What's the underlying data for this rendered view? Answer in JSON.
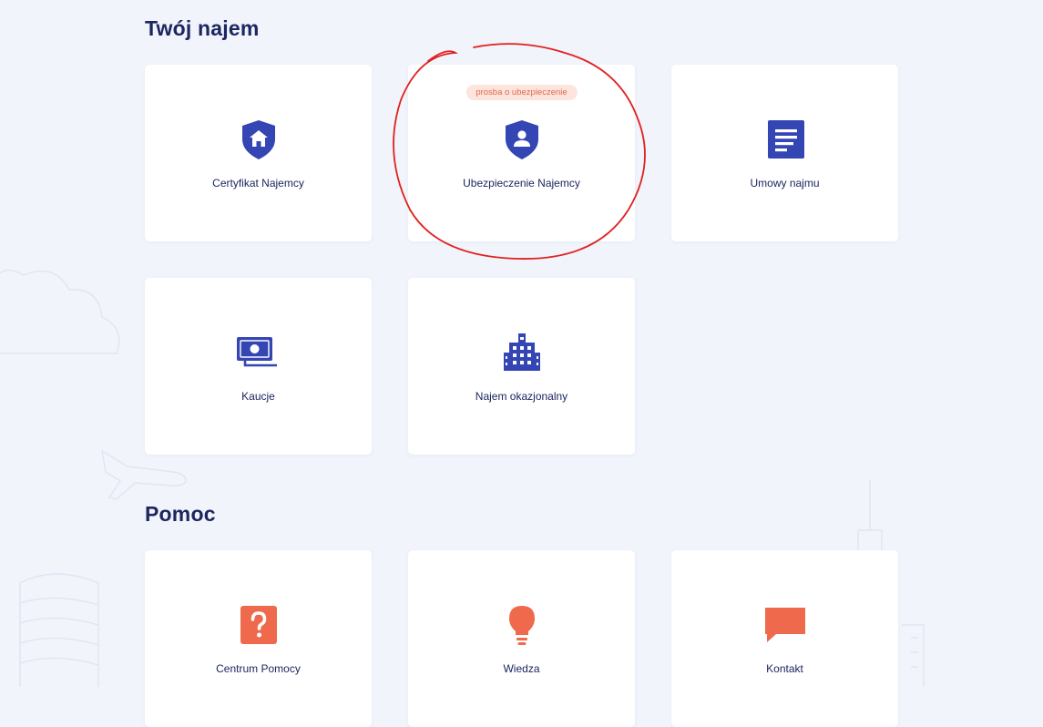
{
  "sections": {
    "rental": {
      "title": "Twój najem",
      "cards": [
        {
          "label": "Certyfikat Najemcy",
          "icon": "shield-home-icon"
        },
        {
          "label": "Ubezpieczenie Najemcy",
          "icon": "shield-user-icon",
          "badge": "prosba o ubezpieczenie"
        },
        {
          "label": "Umowy najmu",
          "icon": "document-icon"
        },
        {
          "label": "Kaucje",
          "icon": "money-icon"
        },
        {
          "label": "Najem okazjonalny",
          "icon": "building-icon"
        }
      ]
    },
    "help": {
      "title": "Pomoc",
      "cards": [
        {
          "label": "Centrum Pomocy",
          "icon": "question-icon"
        },
        {
          "label": "Wiedza",
          "icon": "lightbulb-icon"
        },
        {
          "label": "Kontakt",
          "icon": "chat-bubble-icon"
        }
      ]
    }
  },
  "colors": {
    "background": "#f1f4fb",
    "card": "#ffffff",
    "title": "#1c2660",
    "primary_icon": "#3445b4",
    "help_icon": "#ef6a4c",
    "badge_bg": "#fde4dd",
    "badge_text": "#e0694d",
    "annotation": "#e02020"
  }
}
